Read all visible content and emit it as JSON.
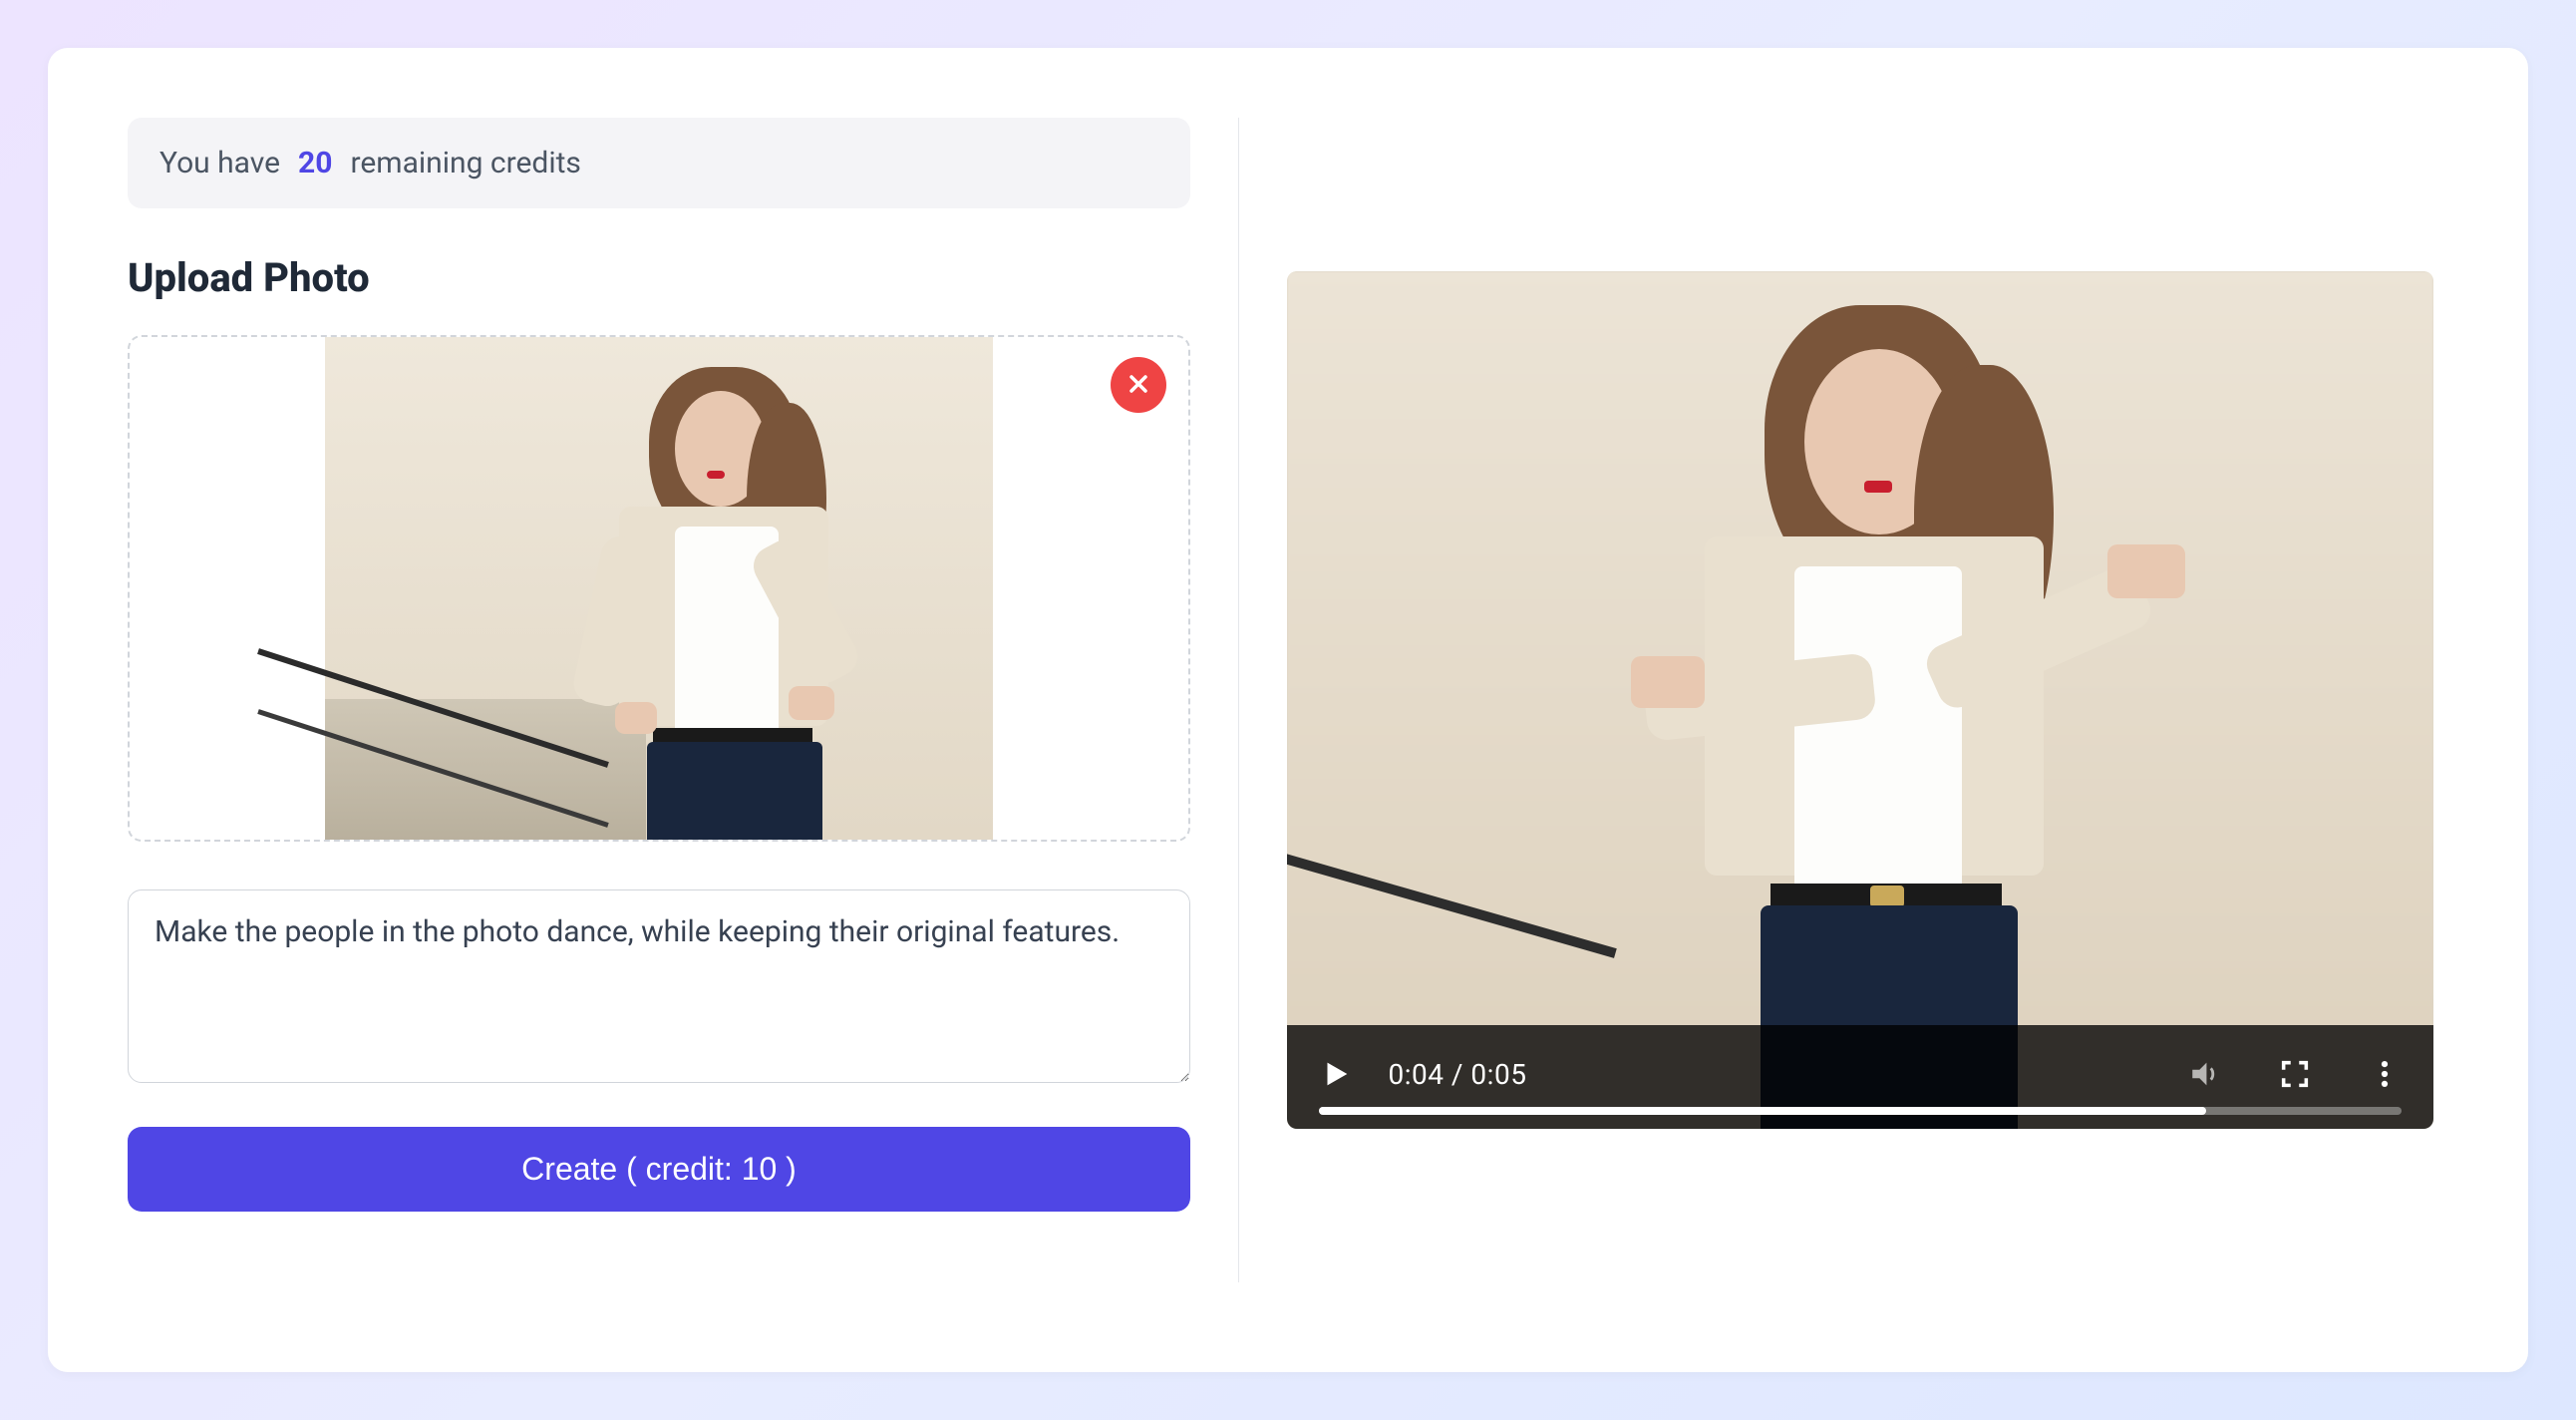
{
  "credits": {
    "prefix": "You have",
    "count": "20",
    "suffix": "remaining credits"
  },
  "upload": {
    "title": "Upload Photo"
  },
  "prompt": {
    "value": "Make the people in the photo dance, while keeping their original features."
  },
  "create": {
    "label": "Create ( credit: 10 )"
  },
  "video": {
    "current_time": "0:04",
    "duration": "0:05",
    "time_display": "0:04 / 0:05",
    "progress_percent": 82
  },
  "colors": {
    "accent": "#4f46e5",
    "danger": "#ef4444"
  }
}
